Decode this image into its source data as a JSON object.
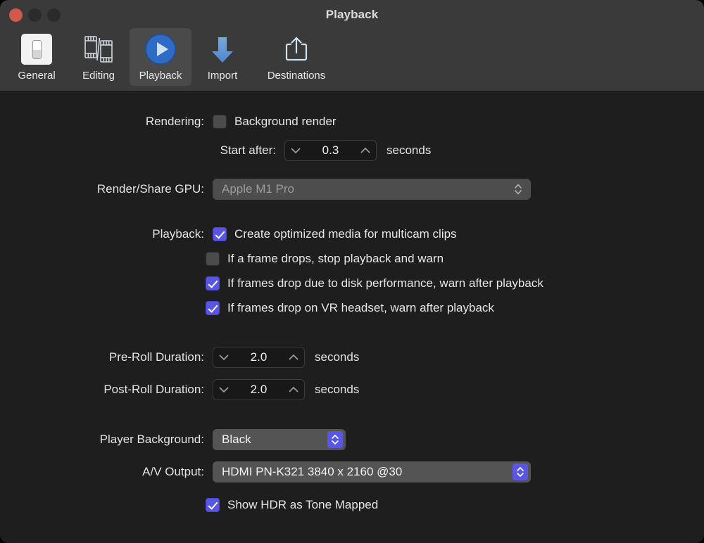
{
  "window": {
    "title": "Playback",
    "traffic_lights": [
      "close",
      "minimize",
      "zoom"
    ]
  },
  "toolbar": {
    "items": [
      {
        "label": "General",
        "icon": "toggle-switch-icon",
        "selected": false
      },
      {
        "label": "Editing",
        "icon": "film-strips-icon",
        "selected": false
      },
      {
        "label": "Playback",
        "icon": "play-circle-icon",
        "selected": true
      },
      {
        "label": "Import",
        "icon": "down-arrow-icon",
        "selected": false
      },
      {
        "label": "Destinations",
        "icon": "share-export-icon",
        "selected": false
      }
    ]
  },
  "colors": {
    "accent": "#5856e2",
    "toolbar_bg": "#3a3a3a",
    "content_bg": "#1e1e1e",
    "selected_tab_bg": "#4a4a4a",
    "close_button": "#cf5a4c"
  },
  "rendering": {
    "label": "Rendering:",
    "background_render": {
      "label": "Background render",
      "checked": false
    },
    "start_after": {
      "label": "Start after:",
      "value": "0.3",
      "unit": "seconds",
      "decrement_icon": "chevron-down-icon",
      "increment_icon": "chevron-up-icon"
    }
  },
  "gpu": {
    "label": "Render/Share GPU:",
    "value": "Apple M1 Pro",
    "disabled": true,
    "chevron_icon": "chevron-up-down-icon"
  },
  "playback": {
    "label": "Playback:",
    "options": [
      {
        "label": "Create optimized media for multicam clips",
        "checked": true
      },
      {
        "label": "If a frame drops, stop playback and warn",
        "checked": false
      },
      {
        "label": "If frames drop due to disk performance, warn after playback",
        "checked": true
      },
      {
        "label": "If frames drop on VR headset, warn after playback",
        "checked": true
      }
    ]
  },
  "pre_roll": {
    "label": "Pre-Roll Duration:",
    "value": "2.0",
    "unit": "seconds",
    "decrement_icon": "chevron-down-icon",
    "increment_icon": "chevron-up-icon"
  },
  "post_roll": {
    "label": "Post-Roll Duration:",
    "value": "2.0",
    "unit": "seconds",
    "decrement_icon": "chevron-down-icon",
    "increment_icon": "chevron-up-icon"
  },
  "player_background": {
    "label": "Player Background:",
    "value": "Black",
    "chevron_icon": "chevron-up-down-icon"
  },
  "av_output": {
    "label": "A/V Output:",
    "value": "HDMI PN-K321 3840 x 2160 @30",
    "chevron_icon": "chevron-up-down-icon"
  },
  "hdr": {
    "label": "Show HDR as Tone Mapped",
    "checked": true
  }
}
